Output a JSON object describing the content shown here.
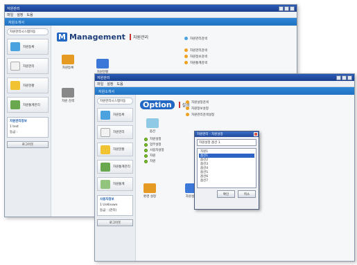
{
  "back_window": {
    "title": "자원관리",
    "menu": [
      "파일",
      "설정",
      "도움"
    ],
    "bluebar": "자원소개서",
    "side_head": "자원관리시스템이동",
    "nav": [
      {
        "label": "자원등록",
        "icon": "server-icon",
        "color": "#4aa3df"
      },
      {
        "label": "자원관리",
        "icon": "document-icon",
        "color": "#f2f2f2"
      },
      {
        "label": "자원현황",
        "icon": "box-icon",
        "color": "#f1c232"
      },
      {
        "label": "자원통계관리",
        "icon": "network-icon",
        "color": "#6aa84f"
      }
    ],
    "info": {
      "head": "자원관리정보",
      "line1": "1 test",
      "line2": "등급 :"
    },
    "logout": "로그아웃",
    "main_title": "Management",
    "main_sub": "자원관리",
    "tiles": [
      {
        "label": "자원등록",
        "icon": "register-icon",
        "color": "#e49a23"
      },
      {
        "label": "자원현황",
        "icon": "status-icon",
        "color": "#3c78d8"
      },
      {
        "label": "자원 검색",
        "icon": "search-icon",
        "color": "#888888"
      }
    ],
    "right_head": "자원관리검색",
    "right_items": [
      "자원관리검색",
      "자원정보검색",
      "자원통계검색"
    ]
  },
  "front_window": {
    "title": "자원관리",
    "menu": [
      "파일",
      "설정",
      "도움"
    ],
    "bluebar": "자원소개서",
    "side_head": "자원관리시스템이동",
    "nav": [
      {
        "label": "자원등록",
        "icon": "server-icon",
        "color": "#4aa3df"
      },
      {
        "label": "자원관리",
        "icon": "document-icon",
        "color": "#f2f2f2"
      },
      {
        "label": "자원현황",
        "icon": "box-icon",
        "color": "#f1c232"
      },
      {
        "label": "자원통계관리",
        "icon": "network-icon",
        "color": "#6aa84f"
      },
      {
        "label": "자원통계",
        "icon": "chart-icon",
        "color": "#93c47d"
      }
    ],
    "info": {
      "head": "사용자정보",
      "line1": "1 UnKnown",
      "line2": "등급 : (관리)"
    },
    "logout": "로그아웃",
    "main_title": "Option",
    "main_sub": "설정",
    "option_tile": "옵션",
    "option_items": [
      "자원설정",
      "업무설정",
      "사용자설정",
      "자원",
      "자원"
    ],
    "right_items": [
      "자원설정검색",
      "자원정보설정",
      "자원관리검색설정"
    ],
    "bottom_tiles": [
      "환경 설정",
      "자원설정"
    ]
  },
  "dialog": {
    "title": "자원관리 - 자원설정",
    "select": "자원설정 옵션 1",
    "options": [
      "자원1",
      "옵션1",
      "옵션2",
      "옵션3",
      "옵션4",
      "옵션5",
      "옵션6",
      "옵션7"
    ],
    "selected_index": 1,
    "ok": "확인",
    "cancel": "취소"
  }
}
